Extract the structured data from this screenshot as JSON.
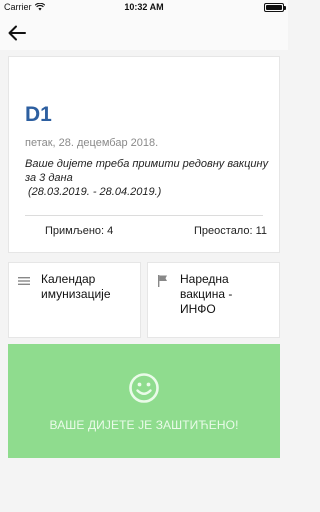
{
  "status_bar": {
    "carrier": "Carrier",
    "time": "10:32 AM"
  },
  "card": {
    "title": "D1",
    "date": "петак, 28. децембар 2018.",
    "message": "Ваше дијете треба примити редовну вакцину за 3 дана",
    "date_range": "(28.03.2019. - 28.04.2019.)",
    "received": "Примљено: 4",
    "remaining": "Преостало: 11"
  },
  "tiles": {
    "calendar": {
      "label_line1": "Календар",
      "label_line2": "имунизације",
      "icon": "list-icon"
    },
    "next_vaccine": {
      "label_line1": "Наредна",
      "label_line2": "вакцина -",
      "label_line3": "ИНФО",
      "icon": "flag-icon"
    }
  },
  "status_panel": {
    "icon": "smiley-icon",
    "text": "ВАШЕ ДИЈЕТЕ ЈЕ ЗАШТИЋЕНО!",
    "color": "#8fdc8e"
  },
  "colors": {
    "accent": "#2d5fa0",
    "success": "#8fdc8e"
  }
}
